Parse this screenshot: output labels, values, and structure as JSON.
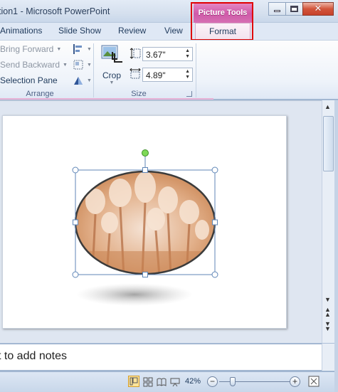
{
  "window": {
    "title": "tion1 - Microsoft PowerPoint",
    "context_tab_group": "Picture Tools"
  },
  "tabs": {
    "animations": "Animations",
    "slide_show": "Slide Show",
    "review": "Review",
    "view": "View",
    "format": "Format"
  },
  "ribbon": {
    "arrange": {
      "bring_forward": "Bring Forward",
      "send_backward": "Send Backward",
      "selection_pane": "Selection Pane",
      "group_label": "Arrange"
    },
    "crop": {
      "label": "Crop"
    },
    "size": {
      "height_value": "3.67\"",
      "width_value": "4.89\"",
      "group_label": "Size"
    }
  },
  "notes": {
    "placeholder": "t to add notes"
  },
  "status": {
    "zoom": "42%",
    "zoom_level": 0.42
  },
  "colors": {
    "context_accent": "#d66fb3",
    "highlight_outline": "#e00000",
    "selection": "#5f86b7",
    "rotate_handle": "#7ed957"
  },
  "icons": [
    "minimize-icon",
    "maximize-icon",
    "close-icon",
    "help-icon",
    "collapse-ribbon-icon",
    "bring-forward-icon",
    "send-backward-icon",
    "selection-pane-icon",
    "align-icon",
    "group-icon",
    "rotate-icon",
    "crop-icon",
    "height-icon",
    "width-icon",
    "normal-view-icon",
    "slide-sorter-icon",
    "reading-view-icon",
    "slide-show-icon",
    "fit-window-icon"
  ]
}
